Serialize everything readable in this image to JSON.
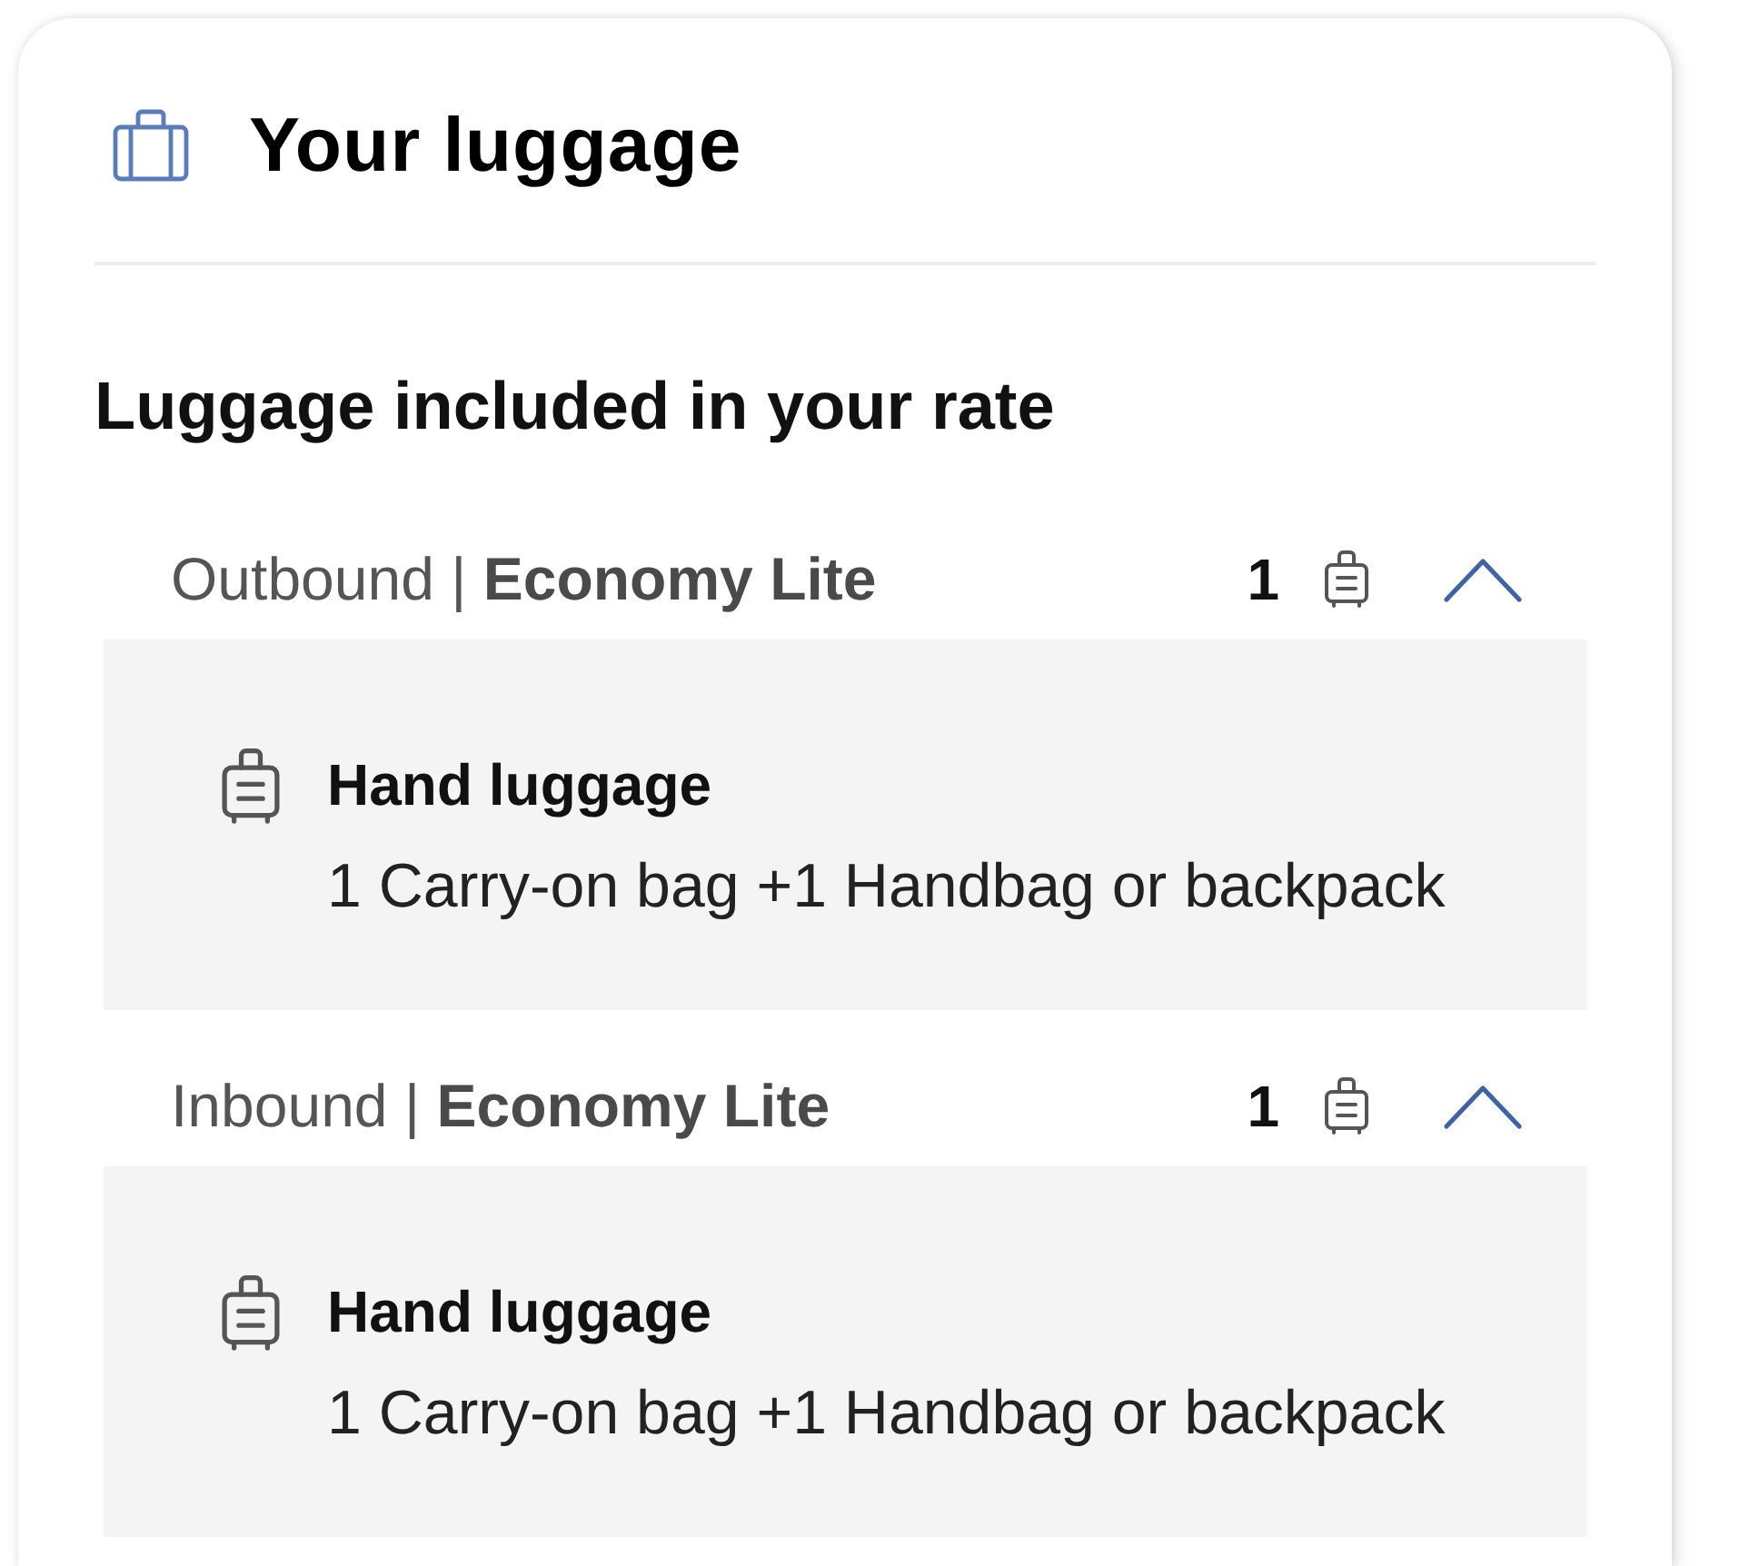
{
  "card": {
    "title": "Your luggage",
    "section_heading": "Luggage included in your rate",
    "segments": [
      {
        "label": "Outbound | **Economy Lite**",
        "count": "1",
        "expanded": true,
        "items": [
          {
            "title": "Hand luggage",
            "detail": "1 Carry-on bag +1 Handbag or backpack"
          }
        ]
      },
      {
        "label": "Inbound | **Economy Lite**",
        "count": "1",
        "expanded": true,
        "items": [
          {
            "title": "Hand luggage",
            "detail": "1 Carry-on bag +1 Handbag or backpack"
          }
        ]
      }
    ]
  }
}
